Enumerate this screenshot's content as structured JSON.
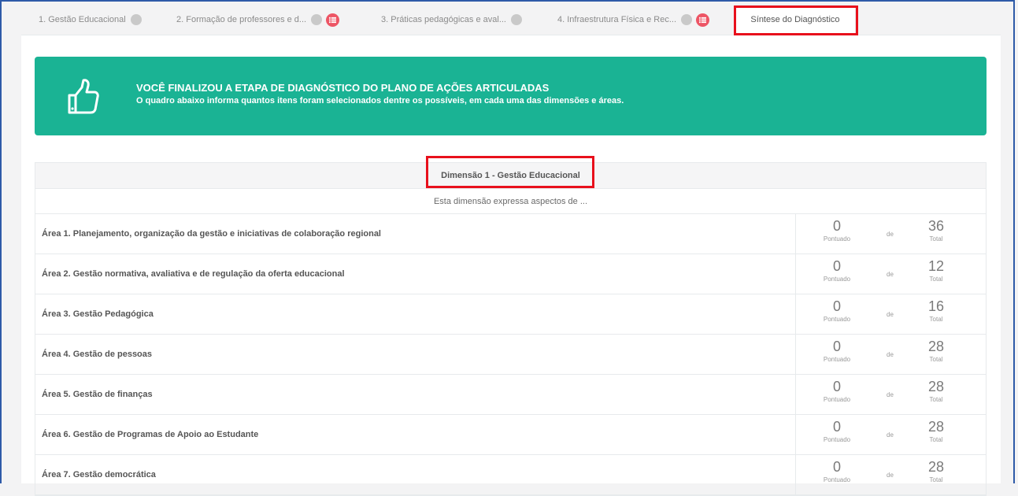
{
  "tabs": [
    {
      "label": "1. Gestão Educacional",
      "has_list_badge": false
    },
    {
      "label": "2. Formação de professores e d...",
      "has_list_badge": true
    },
    {
      "label": "3. Práticas pedagógicas e aval...",
      "has_list_badge": false
    },
    {
      "label": "4. Infraestrutura Física e Rec...",
      "has_list_badge": true
    }
  ],
  "active_tab": {
    "label": "Síntese do Diagnóstico"
  },
  "banner": {
    "icon": "thumbs-up-icon",
    "title": "VOCÊ FINALIZOU A ETAPA DE DIAGNÓSTICO DO PLANO DE AÇÕES ARTICULADAS",
    "subtitle": "O quadro abaixo informa quantos itens foram selecionados dentre os possíveis, em cada uma das dimensões e áreas.",
    "color": "#1ab394"
  },
  "dimension": {
    "title": "Dimensão 1 - Gestão Educacional",
    "description": "Esta dimensão expressa aspectos de ..."
  },
  "score_labels": {
    "scored": "Pontuado",
    "of": "de",
    "total": "Total"
  },
  "areas": [
    {
      "label": "Área 1. Planejamento, organização da gestão e iniciativas de colaboração regional",
      "scored": "0",
      "total": "36"
    },
    {
      "label": "Área 2. Gestão normativa, avaliativa e de regulação da oferta educacional",
      "scored": "0",
      "total": "12"
    },
    {
      "label": "Área 3. Gestão Pedagógica",
      "scored": "0",
      "total": "16"
    },
    {
      "label": "Área 4. Gestão de pessoas",
      "scored": "0",
      "total": "28"
    },
    {
      "label": "Área 5. Gestão de finanças",
      "scored": "0",
      "total": "28"
    },
    {
      "label": "Área 6. Gestão de Programas de Apoio ao Estudante",
      "scored": "0",
      "total": "28"
    },
    {
      "label": "Área 7. Gestão democrática",
      "scored": "0",
      "total": "28"
    }
  ],
  "colors": {
    "highlight": "#e8101c",
    "badge": "#ed5565",
    "frame": "#2e5aa8"
  }
}
